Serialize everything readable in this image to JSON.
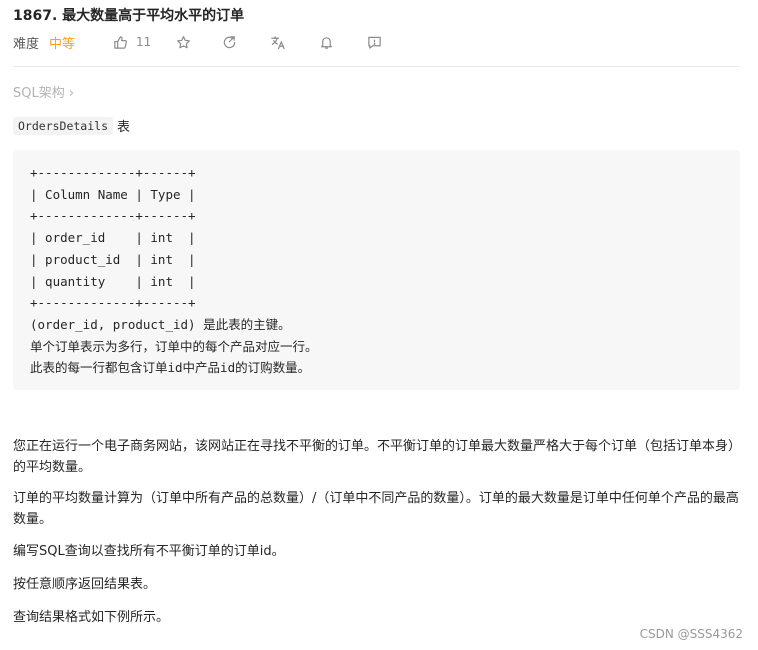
{
  "problem": {
    "title": "1867. 最大数量高于平均水平的订单",
    "difficulty_label": "难度",
    "difficulty": "中等",
    "like_count": "11"
  },
  "toolbar_icons": [
    "thumbs-up-icon",
    "star-icon",
    "share-icon",
    "translate-icon",
    "bell-icon",
    "comment-icon"
  ],
  "tag": "SQL架构 ›",
  "table_intro": {
    "name": "OrdersDetails",
    "suffix": "表"
  },
  "schema_block": "+-------------+------+\n| Column Name | Type |\n+-------------+------+\n| order_id    | int  |\n| product_id  | int  |\n| quantity    | int  |\n+-------------+------+\n(order_id, product_id) 是此表的主键。\n单个订单表示为多行，订单中的每个产品对应一行。\n此表的每一行都包含订单id中产品id的订购数量。",
  "paragraphs": [
    "您正在运行一个电子商务网站，该网站正在寻找不平衡的订单。不平衡订单的订单最大数量严格大于每个订单（包括订单本身）的平均数量。",
    "订单的平均数量计算为（订单中所有产品的总数量）/（订单中不同产品的数量）。订单的最大数量是订单中任何单个产品的最高数量。",
    "编写SQL查询以查找所有不平衡订单的订单id。",
    "按任意顺序返回结果表。",
    "查询结果格式如下例所示。"
  ],
  "watermark": "CSDN @SSS4362",
  "colors": {
    "difficulty": "#ffa116",
    "code_bg": "#f7f7f8",
    "muted": "#8c8c8c"
  }
}
